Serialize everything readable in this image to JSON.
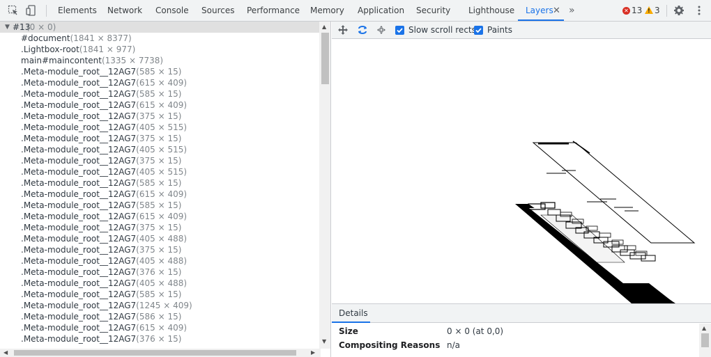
{
  "tabs": [
    {
      "label": "Elements"
    },
    {
      "label": "Network"
    },
    {
      "label": "Console"
    },
    {
      "label": "Sources"
    },
    {
      "label": "Performance"
    },
    {
      "label": "Memory"
    },
    {
      "label": "Application"
    },
    {
      "label": "Security"
    },
    {
      "label": "Lighthouse"
    },
    {
      "label": "Layers"
    }
  ],
  "active_tab": "Layers",
  "toolbar_icons": [
    "inspect-element-icon",
    "device-toolbar-icon"
  ],
  "more_tabs_glyph": "»",
  "status": {
    "errors": "13",
    "warnings": "3"
  },
  "settings_icon": "gear-icon",
  "menu_icon": "kebab-menu-icon",
  "layer_tree": {
    "root": {
      "name": "#13",
      "size": "(0 × 0)"
    },
    "items": [
      {
        "name": "#document",
        "size": "(1841 × 8377)"
      },
      {
        "name": ".Lightbox-root",
        "size": "(1841 × 977)"
      },
      {
        "name": "main#maincontent",
        "size": "(1335 × 7738)"
      },
      {
        "name": ".Meta-module_root__12AG7",
        "size": "(585 × 15)"
      },
      {
        "name": ".Meta-module_root__12AG7",
        "size": "(615 × 409)"
      },
      {
        "name": ".Meta-module_root__12AG7",
        "size": "(585 × 15)"
      },
      {
        "name": ".Meta-module_root__12AG7",
        "size": "(615 × 409)"
      },
      {
        "name": ".Meta-module_root__12AG7",
        "size": "(375 × 15)"
      },
      {
        "name": ".Meta-module_root__12AG7",
        "size": "(405 × 515)"
      },
      {
        "name": ".Meta-module_root__12AG7",
        "size": "(375 × 15)"
      },
      {
        "name": ".Meta-module_root__12AG7",
        "size": "(405 × 515)"
      },
      {
        "name": ".Meta-module_root__12AG7",
        "size": "(375 × 15)"
      },
      {
        "name": ".Meta-module_root__12AG7",
        "size": "(405 × 515)"
      },
      {
        "name": ".Meta-module_root__12AG7",
        "size": "(585 × 15)"
      },
      {
        "name": ".Meta-module_root__12AG7",
        "size": "(615 × 409)"
      },
      {
        "name": ".Meta-module_root__12AG7",
        "size": "(585 × 15)"
      },
      {
        "name": ".Meta-module_root__12AG7",
        "size": "(615 × 409)"
      },
      {
        "name": ".Meta-module_root__12AG7",
        "size": "(375 × 15)"
      },
      {
        "name": ".Meta-module_root__12AG7",
        "size": "(405 × 488)"
      },
      {
        "name": ".Meta-module_root__12AG7",
        "size": "(375 × 15)"
      },
      {
        "name": ".Meta-module_root__12AG7",
        "size": "(405 × 488)"
      },
      {
        "name": ".Meta-module_root__12AG7",
        "size": "(376 × 15)"
      },
      {
        "name": ".Meta-module_root__12AG7",
        "size": "(405 × 488)"
      },
      {
        "name": ".Meta-module_root__12AG7",
        "size": "(585 × 15)"
      },
      {
        "name": ".Meta-module_root__12AG7",
        "size": "(1245 × 409)"
      },
      {
        "name": ".Meta-module_root__12AG7",
        "size": "(586 × 15)"
      },
      {
        "name": ".Meta-module_root__12AG7",
        "size": "(615 × 409)"
      },
      {
        "name": ".Meta-module_root__12AG7",
        "size": "(376 × 15)"
      }
    ]
  },
  "layers_toolbar": {
    "pan_icon": "pan-mode-icon",
    "rotate_icon": "rotate-mode-icon",
    "reset_icon": "reset-transform-icon",
    "slow_scroll_label": "Slow scroll rects",
    "slow_scroll_checked": true,
    "paints_label": "Paints",
    "paints_checked": true
  },
  "details": {
    "tab_label": "Details",
    "rows": [
      {
        "key": "Size",
        "value": "0 × 0 (at 0,0)"
      },
      {
        "key": "Compositing Reasons",
        "value": "n/a"
      }
    ]
  },
  "colors": {
    "accent": "#1a73e8",
    "error": "#d93025",
    "warning": "#f9ab00"
  }
}
